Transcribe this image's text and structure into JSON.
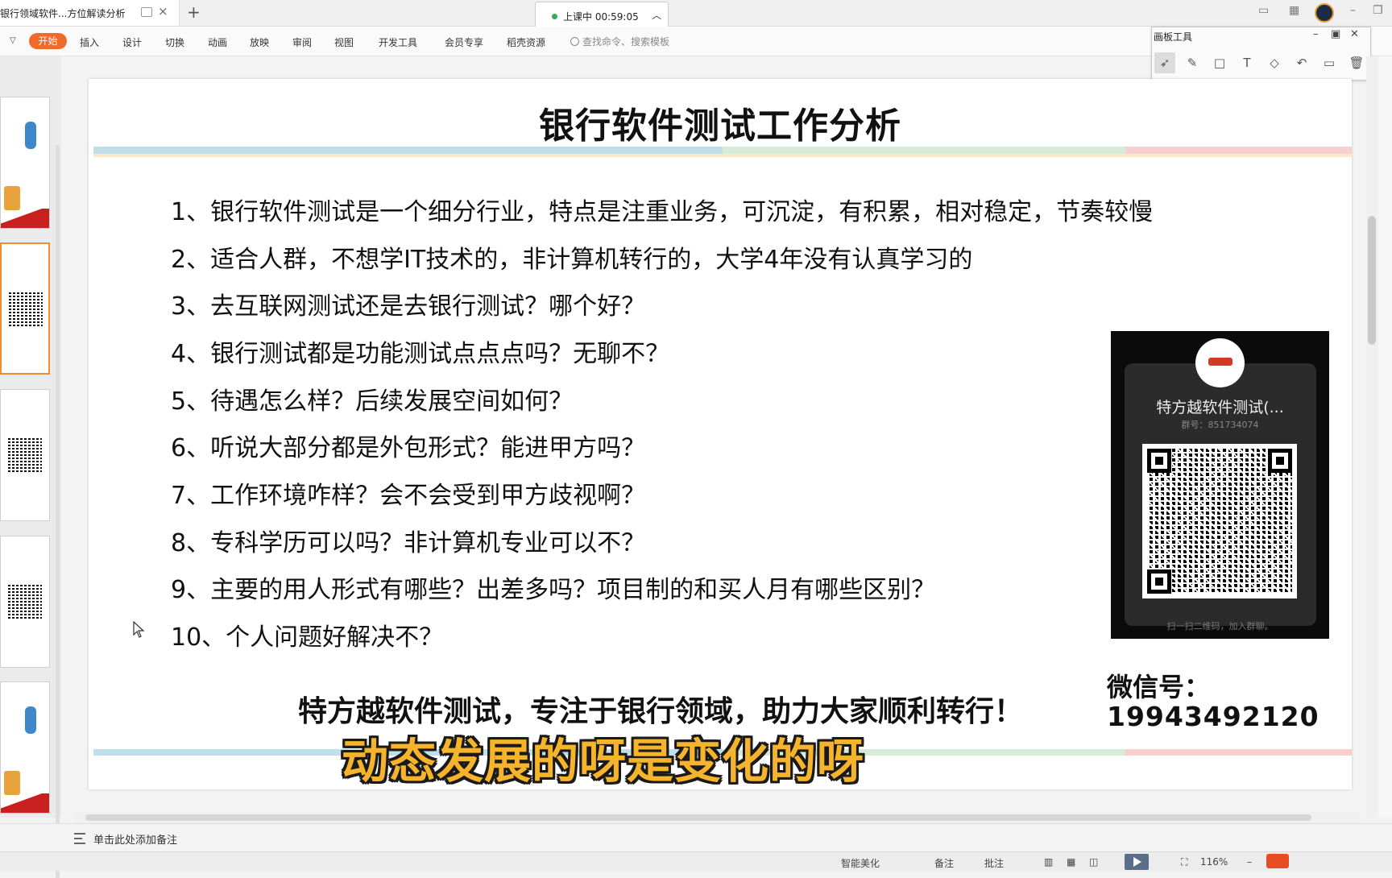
{
  "tab": {
    "title": "银行领域软件...方位解读分析"
  },
  "session": {
    "status": "上课中 00:59:05"
  },
  "ribbon": {
    "start": "开始",
    "items": [
      "插入",
      "设计",
      "切换",
      "动画",
      "放映",
      "审阅",
      "视图",
      "开发工具",
      "会员专享",
      "稻壳资源"
    ],
    "search_placeholder": "查找命令、搜索模板"
  },
  "drawing_panel": {
    "title": "画板工具"
  },
  "slide": {
    "title": "银行软件测试工作分析",
    "questions": [
      "1、银行软件测试是一个细分行业，特点是注重业务，可沉淀，有积累，相对稳定，节奏较慢",
      "2、适合人群，不想学IT技术的，非计算机转行的，大学4年没有认真学习的",
      "3、去互联网测试还是去银行测试？哪个好？",
      "4、银行测试都是功能测试点点点吗？无聊不？",
      "5、待遇怎么样？后续发展空间如何？",
      "6、听说大部分都是外包形式？能进甲方吗？",
      "7、工作环境咋样？会不会受到甲方歧视啊？",
      "8、专科学历可以吗？非计算机专业可以不？",
      "9、主要的用人形式有哪些？出差多吗？项目制的和买人月有哪些区别？",
      "10、个人问题好解决不？"
    ],
    "slogan": "特方越软件测试，专注于银行领域，助力大家顺利转行！",
    "wechat_label": "微信号：",
    "wechat_number": "19943492120",
    "qr": {
      "group_name": "特方越软件测试(...",
      "group_id": "群号：851734074",
      "hint": "扫一扫二维码，加入群聊。"
    }
  },
  "subtitle": "动态发展的呀是变化的呀",
  "notes": {
    "placeholder": "单击此处添加备注"
  },
  "statusbar": {
    "beautify": "智能美化",
    "remark": "备注",
    "comment": "批注",
    "zoom": "116%"
  },
  "colors": {
    "accent": "#f06a2b",
    "subtitle": "#f6b42c"
  }
}
